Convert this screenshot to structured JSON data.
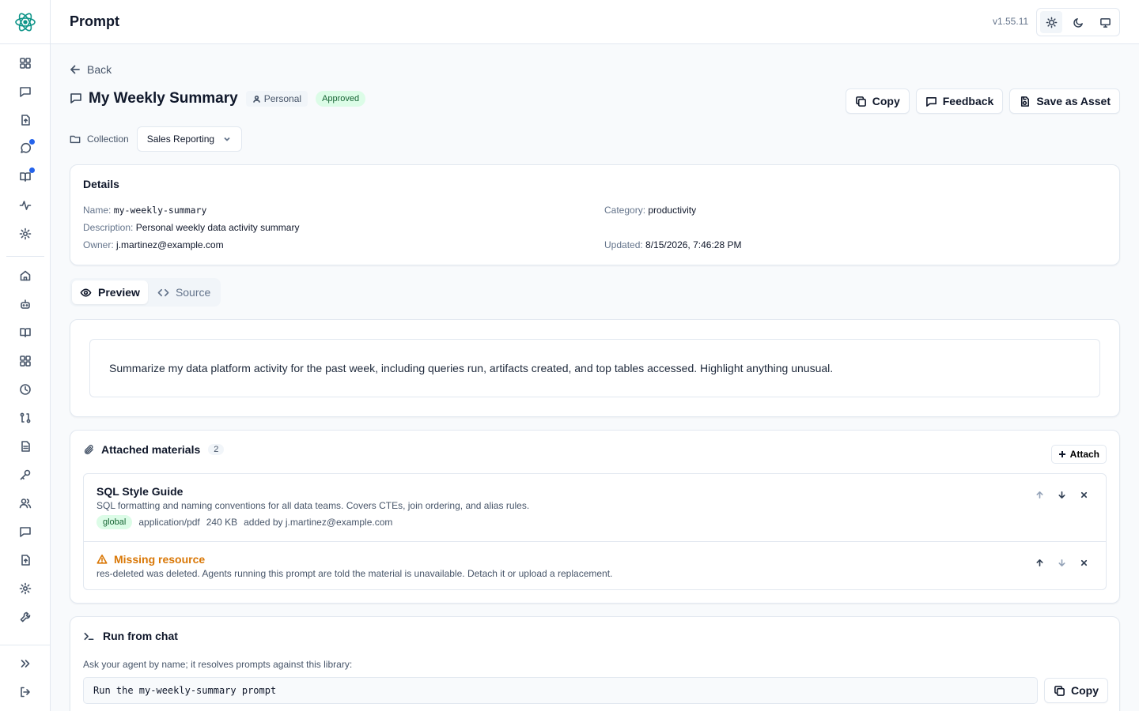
{
  "app": {
    "title": "Prompt",
    "version": "v1.55.11"
  },
  "nav": {
    "back_label": "Back"
  },
  "prompt": {
    "title": "My Weekly Summary",
    "scope_badge": "Personal",
    "status_badge": "Approved",
    "collection_label": "Collection",
    "collection_value": "Sales Reporting"
  },
  "actions": {
    "copy_label": "Copy",
    "feedback_label": "Feedback",
    "save_asset_label": "Save as Asset"
  },
  "details": {
    "heading": "Details",
    "name_key": "Name:",
    "name_value": "my-weekly-summary",
    "description_key": "Description:",
    "description_value": "Personal weekly data activity summary",
    "owner_key": "Owner:",
    "owner_value": "j.martinez@example.com",
    "category_key": "Category:",
    "category_value": "productivity",
    "updated_key": "Updated:",
    "updated_value": "8/15/2026, 7:46:28 PM"
  },
  "tabs": {
    "preview": "Preview",
    "source": "Source",
    "active": "preview"
  },
  "preview": {
    "text": "Summarize my data platform activity for the past week, including queries run, artifacts created, and top tables accessed. Highlight anything unusual."
  },
  "attachments": {
    "heading": "Attached materials",
    "count": "2",
    "attach_label": "Attach",
    "items": [
      {
        "title": "SQL Style Guide",
        "description": "SQL formatting and naming conventions for all data teams. Covers CTEs, join ordering, and alias rules.",
        "tag": "global",
        "mime": "application/pdf",
        "size": "240 KB",
        "added_by": "added by j.martinez@example.com"
      },
      {
        "title": "Missing resource",
        "description": "res-deleted was deleted. Agents running this prompt are told the material is unavailable. Detach it or upload a replacement."
      }
    ]
  },
  "run": {
    "heading": "Run from chat",
    "hint": "Ask your agent by name; it resolves prompts against this library:",
    "command": "Run the my-weekly-summary prompt",
    "copy_label": "Copy"
  },
  "colors": {
    "accent": "#2563eb",
    "approved_bg": "#dcfce7",
    "warning": "#d97706"
  }
}
